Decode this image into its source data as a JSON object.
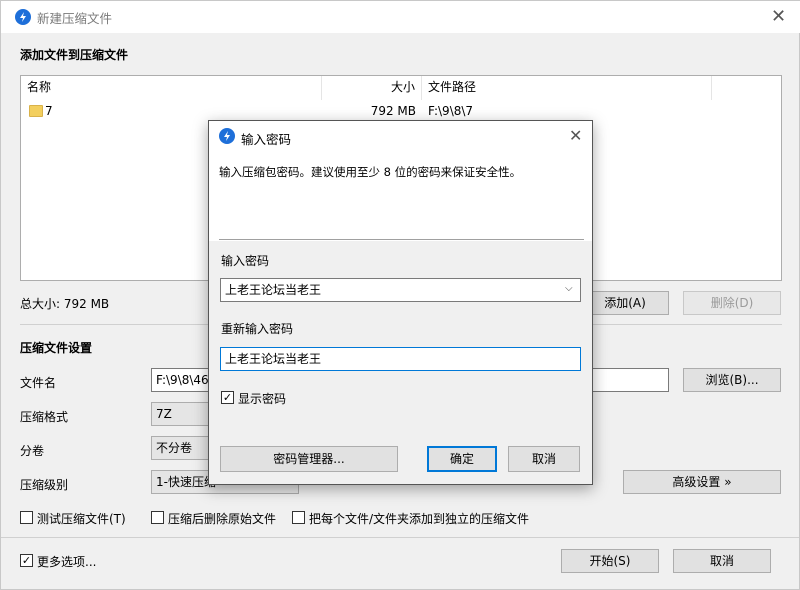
{
  "main": {
    "title": "新建压缩文件",
    "add_section_title": "添加文件到压缩文件",
    "columns": {
      "name": "名称",
      "size": "大小",
      "path": "文件路径"
    },
    "rows": [
      {
        "name": "7",
        "size": "792 MB",
        "path": "F:\\9\\8\\7"
      }
    ],
    "total_size": "总大小: 792 MB",
    "add_button": "添加(A)",
    "delete_button": "删除(D)",
    "settings_title": "压缩文件设置",
    "filename_label": "文件名",
    "filename_value": "F:\\9\\8\\46",
    "browse_button": "浏览(B)...",
    "format_label": "压缩格式",
    "format_value": "7Z",
    "split_label": "分卷",
    "split_value": "不分卷",
    "level_label": "压缩级别",
    "level_value": "1-快速压缩",
    "advanced_button": "高级设置 »",
    "test_checkbox": "测试压缩文件(T)",
    "delete_after_checkbox": "压缩后删除原始文件",
    "separate_checkbox": "把每个文件/文件夹添加到独立的压缩文件",
    "more_options": "更多选项...",
    "start_button": "开始(S)",
    "cancel_button": "取消"
  },
  "dialog": {
    "title": "输入密码",
    "description": "输入压缩包密码。建议使用至少 8 位的密码来保证安全性。",
    "password_label": "输入密码",
    "password_value": "上老王论坛当老王",
    "confirm_label": "重新输入密码",
    "confirm_value": "上老王论坛当老王",
    "show_password": "显示密码",
    "show_password_checked": true,
    "manager_button": "密码管理器...",
    "ok_button": "确定",
    "cancel_button": "取消"
  },
  "colors": {
    "accent": "#0078d7",
    "app_icon": "#1e6fd9",
    "folder": "#f3cf5e"
  }
}
